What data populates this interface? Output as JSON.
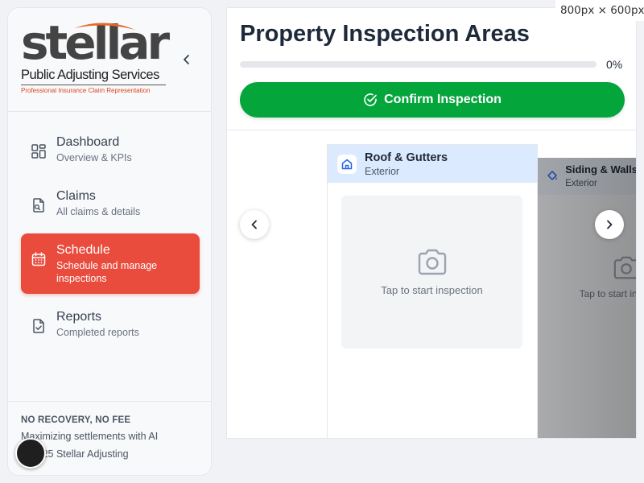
{
  "logo": {
    "word": "stellar",
    "subtitle": "Public Adjusting Services",
    "tagline": "Professional Insurance Claim Representation",
    "accent_color": "#e8672a"
  },
  "sidebar": {
    "items": [
      {
        "title": "Dashboard",
        "subtitle": "Overview & KPIs",
        "icon": "dashboard-grid-icon",
        "active": false
      },
      {
        "title": "Claims",
        "subtitle": "All claims & details",
        "icon": "claims-document-icon",
        "active": false
      },
      {
        "title": "Schedule",
        "subtitle": "Schedule and manage inspections",
        "icon": "calendar-icon",
        "active": true
      },
      {
        "title": "Reports",
        "subtitle": "Completed reports",
        "icon": "report-check-icon",
        "active": false
      }
    ],
    "active_color": "#e94b3c",
    "footer": {
      "title": "NO RECOVERY, NO FEE",
      "subtitle": "Maximizing settlements with AI",
      "copyright": "© 2025 Stellar Adjusting"
    }
  },
  "main": {
    "title": "Property Inspection Areas",
    "progress": {
      "value": 0,
      "label": "0%"
    },
    "confirm_button": "Confirm Inspection",
    "confirm_color": "#04a63c",
    "cards": [
      {
        "title": "Roof & Gutters",
        "subtitle": "Exterior",
        "icon": "home-icon",
        "photo_prompt": "Tap to start inspection"
      },
      {
        "title": "Siding & Walls",
        "subtitle": "Exterior",
        "icon": "paint-bucket-icon",
        "photo_prompt": "Tap to start inspection"
      }
    ]
  },
  "dimension_label": "800px × 600px"
}
